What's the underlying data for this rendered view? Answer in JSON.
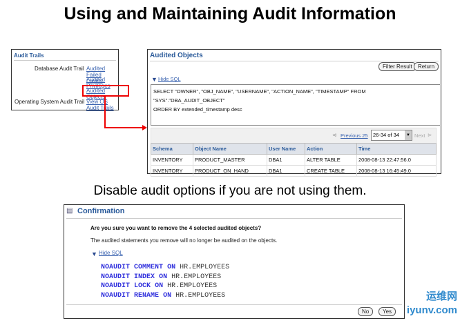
{
  "title": "Using and Maintaining Audit Information",
  "subtitle": "Disable audit options if you are not using them.",
  "audit_trails": {
    "heading": "Audit Trails",
    "db_label": "Database Audit Trail",
    "links": [
      "Audited Failed Logins",
      "Audited Privileges",
      "Audited Objects"
    ],
    "os_label": "Operating System Audit Trail",
    "os_link": "View OS Audit Trails"
  },
  "audited_objects": {
    "heading": "Audited Objects",
    "filter_button": "Filter Result",
    "return_button": "Return",
    "hide_sql": "Hide SQL",
    "sql_line1": "SELECT \"OWNER\", \"OBJ_NAME\", \"USERNAME\", \"ACTION_NAME\", \"TIMESTAMP\" FROM \"SYS\".\"DBA_AUDIT_OBJECT\"",
    "sql_line2": "ORDER BY extended_timestamp desc",
    "previous": "Previous 25",
    "range": "26-34 of 34",
    "next": "Next",
    "columns": [
      "Schema",
      "Object Name",
      "User Name",
      "Action",
      "Time"
    ],
    "rows": [
      [
        "INVENTORY",
        "PRODUCT_MASTER",
        "DBA1",
        "ALTER TABLE",
        "2008-08-13 22:47:56.0"
      ],
      [
        "INVENTORY",
        "PRODUCT_ON_HAND",
        "DBA1",
        "CREATE TABLE",
        "2008-08-13 16:45:49.0"
      ]
    ]
  },
  "confirmation": {
    "heading": "Confirmation",
    "question": "Are you sure you want to remove the 4 selected audited objects?",
    "note": "The audited statements you remove will no longer be audited on the objects.",
    "hide_sql": "Hide SQL",
    "statements": [
      {
        "kw1": "NOAUDIT",
        "kw2": "COMMENT",
        "kw3": "ON",
        "obj": "HR.EMPLOYEES"
      },
      {
        "kw1": "NOAUDIT",
        "kw2": "INDEX",
        "kw3": "ON",
        "obj": "HR.EMPLOYEES"
      },
      {
        "kw1": "NOAUDIT",
        "kw2": "LOCK",
        "kw3": "ON",
        "obj": "HR.EMPLOYEES"
      },
      {
        "kw1": "NOAUDIT",
        "kw2": "RENAME",
        "kw3": "ON",
        "obj": "HR.EMPLOYEES"
      }
    ],
    "no_button": "No",
    "yes_button": "Yes"
  },
  "watermark": "运维网 iyunv.com"
}
